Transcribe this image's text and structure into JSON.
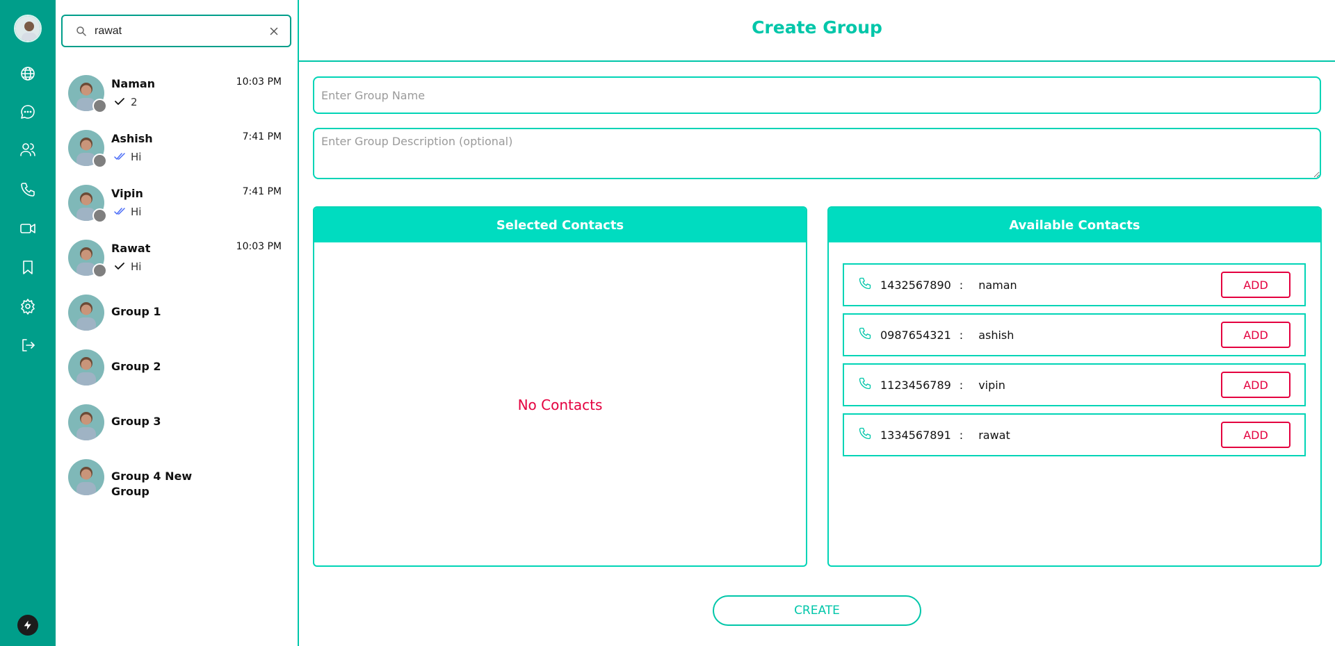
{
  "rail": {
    "icons": [
      "globe-icon",
      "chat-bubble-icon",
      "users-icon",
      "phone-icon",
      "video-icon",
      "bookmark-icon",
      "gear-icon",
      "logout-icon",
      "bolt-icon"
    ],
    "accent": "#009e8a"
  },
  "search": {
    "value": "rawat"
  },
  "chats": [
    {
      "name": "Naman",
      "time": "10:03 PM",
      "message": "2",
      "tick": "single"
    },
    {
      "name": "Ashish",
      "time": "7:41 PM",
      "message": "Hi",
      "tick": "double"
    },
    {
      "name": "Vipin",
      "time": "7:41 PM",
      "message": "Hi",
      "tick": "double"
    },
    {
      "name": "Rawat",
      "time": "10:03 PM",
      "message": "Hi",
      "tick": "single"
    },
    {
      "name": "Group 1"
    },
    {
      "name": "Group 2"
    },
    {
      "name": "Group 3"
    },
    {
      "name": "Group 4 New Group"
    }
  ],
  "main": {
    "title": "Create Group",
    "group_name_placeholder": "Enter Group Name",
    "group_desc_placeholder": "Enter Group Description (optional)",
    "selected_title": "Selected Contacts",
    "no_contacts": "No Contacts",
    "available_title": "Available Contacts",
    "separator": ":",
    "add_label": "ADD",
    "contacts": [
      {
        "number": "1432567890",
        "name": "naman"
      },
      {
        "number": "0987654321",
        "name": "ashish"
      },
      {
        "number": "1123456789",
        "name": "vipin"
      },
      {
        "number": "1334567891",
        "name": "rawat"
      }
    ],
    "create_label": "CREATE"
  },
  "colors": {
    "teal": "#00c6a9",
    "header": "#00dcc0",
    "danger": "#e4003f"
  }
}
